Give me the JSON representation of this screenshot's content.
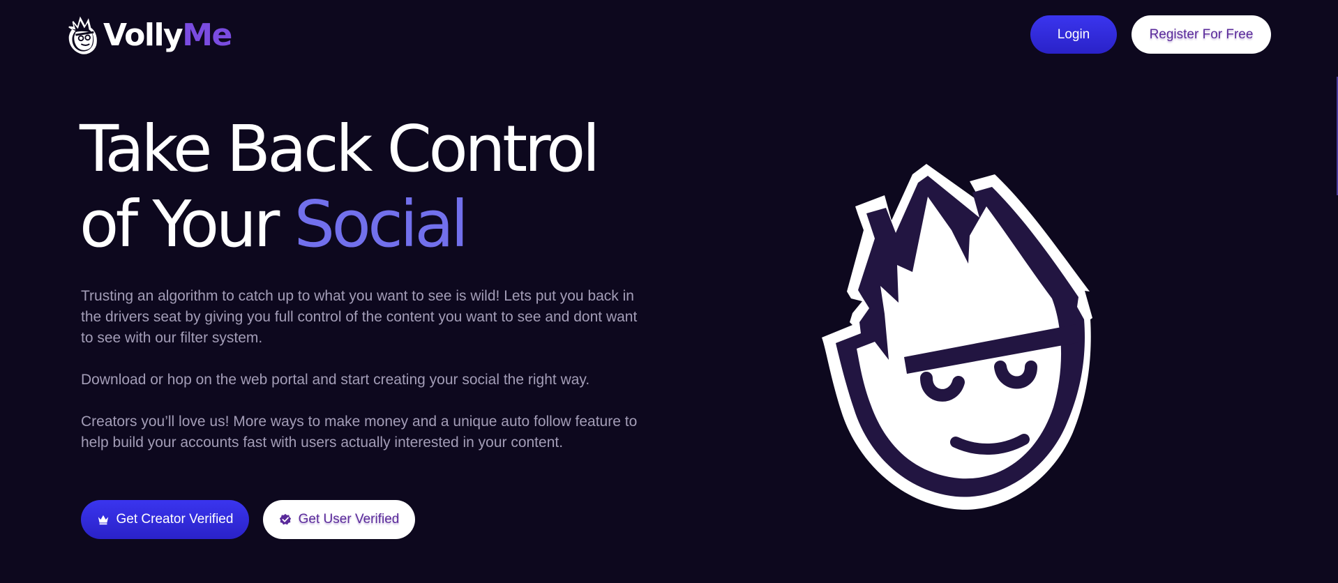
{
  "header": {
    "logo": {
      "part1": "Volly",
      "part2": "Me",
      "icon": "mascot-logo-icon"
    },
    "login_label": "Login",
    "register_label": "Register For Free"
  },
  "hero": {
    "title_line1": "Take Back Control",
    "title_line2_plain": "of Your ",
    "title_line2_accent": "Social",
    "paragraphs": [
      "Trusting an algorithm to catch up to what you want to see is wild! Lets put you back in the drivers seat by giving you full control of the content you want to see and dont want to see with our filter system.",
      "Download or hop on the web portal and start creating your social the right way.",
      "Creators you’ll love us! More ways to make money and a unique auto follow feature to help build your accounts fast with users actually interested in your content."
    ],
    "cta_creator": {
      "label": "Get Creator Verified",
      "icon": "crown-icon"
    },
    "cta_user": {
      "label": "Get User Verified",
      "icon": "verified-badge-icon"
    },
    "illustration_icon": "mascot-face-icon"
  },
  "colors": {
    "background": "#0d081e",
    "accent_text": "#7270ec",
    "logo_me": "#7a4ce0",
    "primary_button": "#2f29de",
    "secondary_button_text": "#5a2a9a",
    "body_text": "#a39db7"
  }
}
